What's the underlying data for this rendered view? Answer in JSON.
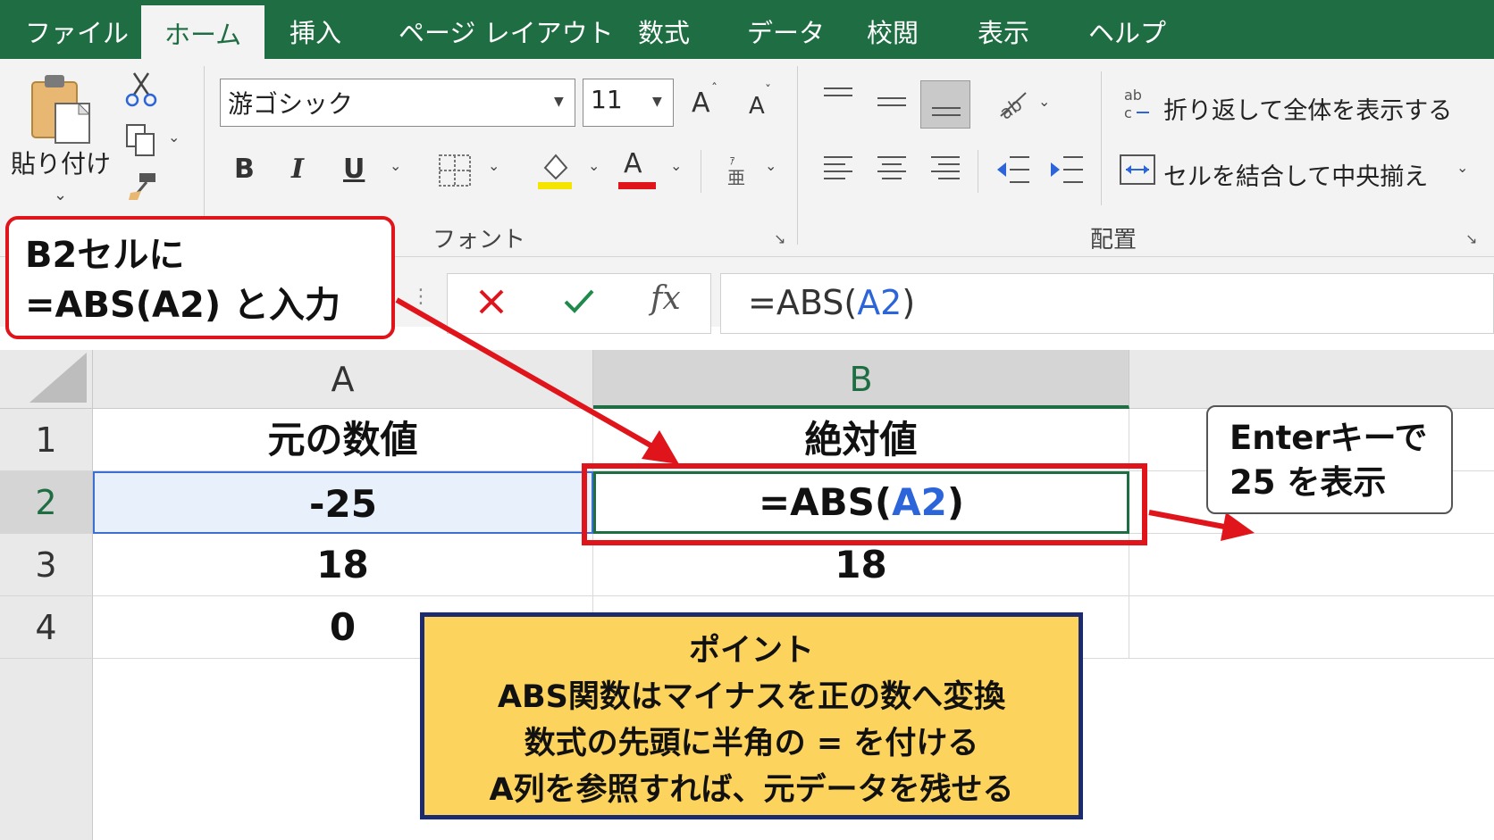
{
  "tabs": [
    {
      "label": "ファイル",
      "active": false
    },
    {
      "label": "ホーム",
      "active": true
    },
    {
      "label": "挿入",
      "active": false
    },
    {
      "label": "ページ レイアウト",
      "active": false
    },
    {
      "label": "数式",
      "active": false
    },
    {
      "label": "データ",
      "active": false
    },
    {
      "label": "校閲",
      "active": false
    },
    {
      "label": "表示",
      "active": false
    },
    {
      "label": "ヘルプ",
      "active": false
    }
  ],
  "ribbon": {
    "paste_label": "貼り付け",
    "font_name": "游ゴシック",
    "font_size": "11",
    "bold": "B",
    "italic": "I",
    "underline": "U",
    "grow_font": "A",
    "shrink_font": "A",
    "font_color_glyph": "A",
    "font_group_label": "フォント",
    "align_group_label": "配置",
    "wrap_text_label": "折り返して全体を表示する",
    "merge_center_label": "セルを結合して中央揃え"
  },
  "formula_bar": {
    "formula_prefix": "=ABS(",
    "formula_ref": "A2",
    "formula_suffix": ")",
    "fx": "fx"
  },
  "sheet": {
    "columns": [
      "A",
      "B"
    ],
    "rows": [
      "1",
      "2",
      "3",
      "4"
    ],
    "cells": {
      "A1": "元の数値",
      "B1": "絶対値",
      "A2": "-25",
      "B2_prefix": "=ABS(",
      "B2_ref": "A2",
      "B2_suffix": ")",
      "A3": "18",
      "B3": "18",
      "A4": "0"
    },
    "active_cell": "B2",
    "referenced_cell": "A2"
  },
  "callouts": {
    "input_line1": "B2セルに",
    "input_line2": "=ABS(A2) と入力",
    "enter_line1": "Enterキーで",
    "enter_line2": "25 を表示",
    "point_title": "ポイント",
    "point_line1": "ABS関数はマイナスを正の数へ変換",
    "point_line2": "数式の先頭に半角の = を付ける",
    "point_line3": "A列を参照すれば、元データを残せる"
  },
  "colors": {
    "excel_green": "#1f6e43",
    "highlight_red": "#e0141b",
    "ref_blue": "#2b65d9",
    "point_yellow": "#fcd35d",
    "point_border": "#1c2a6e"
  }
}
